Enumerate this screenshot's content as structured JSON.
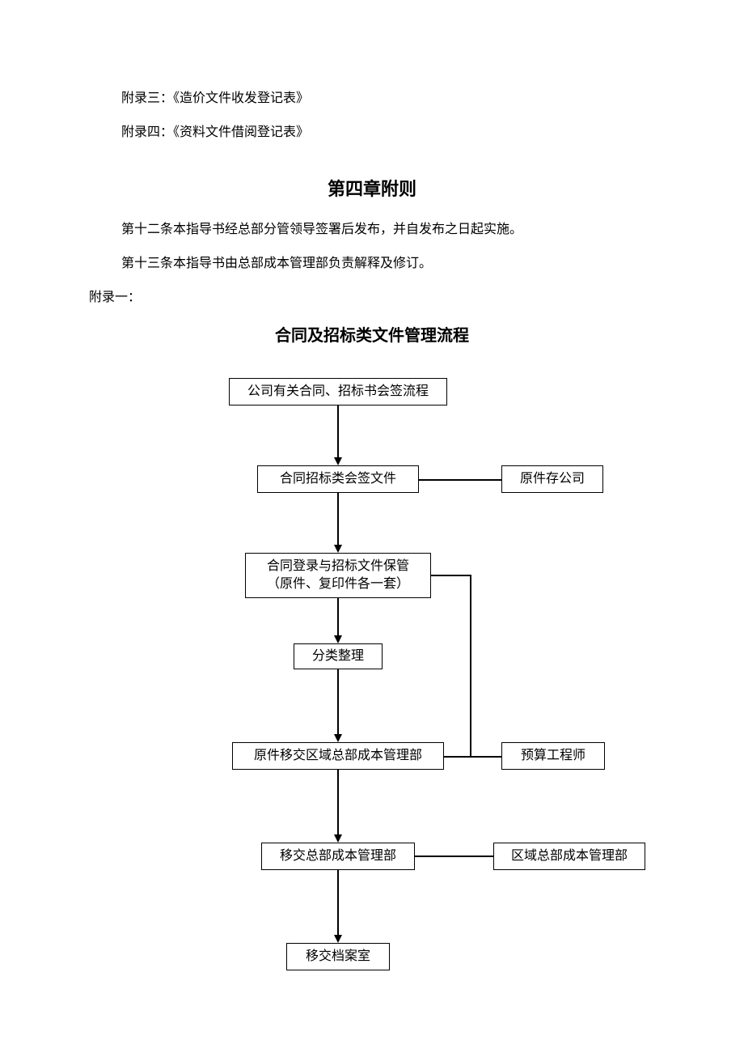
{
  "appendix": {
    "item3": "附录三：《造价文件收发登记表》",
    "item4": "附录四：《资料文件借阅登记表》",
    "annex1_label": "附录一："
  },
  "chapter": {
    "title": "第四章附则",
    "clause12": "第十二条本指导书经总部分管领导签署后发布，并自发布之日起实施。",
    "clause13": "第十三条本指导书由总部成本管理部负责解释及修订。"
  },
  "flow": {
    "title": "合同及招标类文件管理流程",
    "nodes": {
      "n1": "公司有关合同、招标书会签流程",
      "n2": "合同招标类会签文件",
      "n2s": "原件存公司",
      "n3": "合同登录与招标文件保管\n（原件、复印件各一套）",
      "n4": "分类整理",
      "n5": "原件移交区域总部成本管理部",
      "n5s": "预算工程师",
      "n6": "移交总部成本管理部",
      "n6s": "区域总部成本管理部",
      "n7": "移交档案室"
    }
  }
}
